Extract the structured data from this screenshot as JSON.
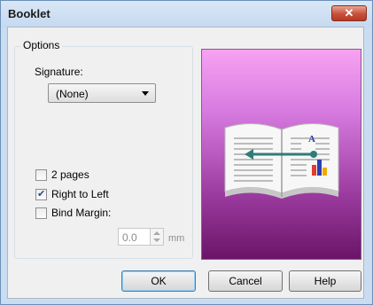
{
  "window": {
    "title": "Booklet",
    "close_glyph": "✕"
  },
  "options": {
    "group_label": "Options",
    "signature_label": "Signature:",
    "signature_value": "(None)",
    "two_pages_label": "2 pages",
    "two_pages_checked": false,
    "right_to_left_label": "Right to Left",
    "right_to_left_checked": true,
    "bind_margin_label": "Bind Margin:",
    "bind_margin_checked": false,
    "bind_margin_value": "0.0",
    "bind_margin_unit": "mm"
  },
  "preview": {
    "letter": "A",
    "icon": "booklet-preview-illustration"
  },
  "buttons": {
    "ok": "OK",
    "cancel": "Cancel",
    "help": "Help"
  },
  "colors": {
    "accent": "#3c7fb1",
    "arrow": "#2e7d77",
    "close": "#c8503a"
  }
}
